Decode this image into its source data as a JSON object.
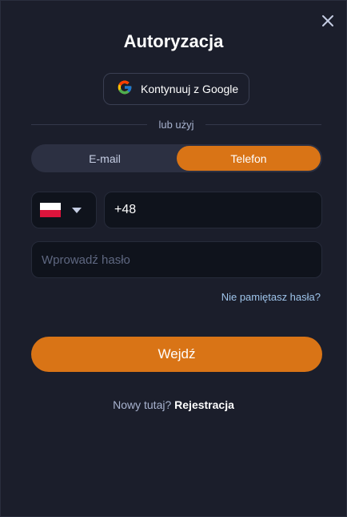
{
  "modal": {
    "title": "Autoryzacja",
    "google_button_label": "Kontynuuj z Google",
    "divider_text": "lub użyj",
    "tabs": [
      {
        "label": "E-mail",
        "active": false
      },
      {
        "label": "Telefon",
        "active": true
      }
    ],
    "country": {
      "flag": "poland-flag-icon"
    },
    "phone": {
      "value": "+48"
    },
    "password": {
      "placeholder": "Wprowadź hasło",
      "value": ""
    },
    "forgot_label": "Nie pamiętasz hasła?",
    "submit_label": "Wejdź",
    "register_question": "Nowy tutaj?",
    "register_link": "Rejestracja"
  },
  "colors": {
    "background": "#1b1e2b",
    "accent": "#d97416",
    "input_bg": "#0f131c",
    "link": "#9ec4ea"
  }
}
